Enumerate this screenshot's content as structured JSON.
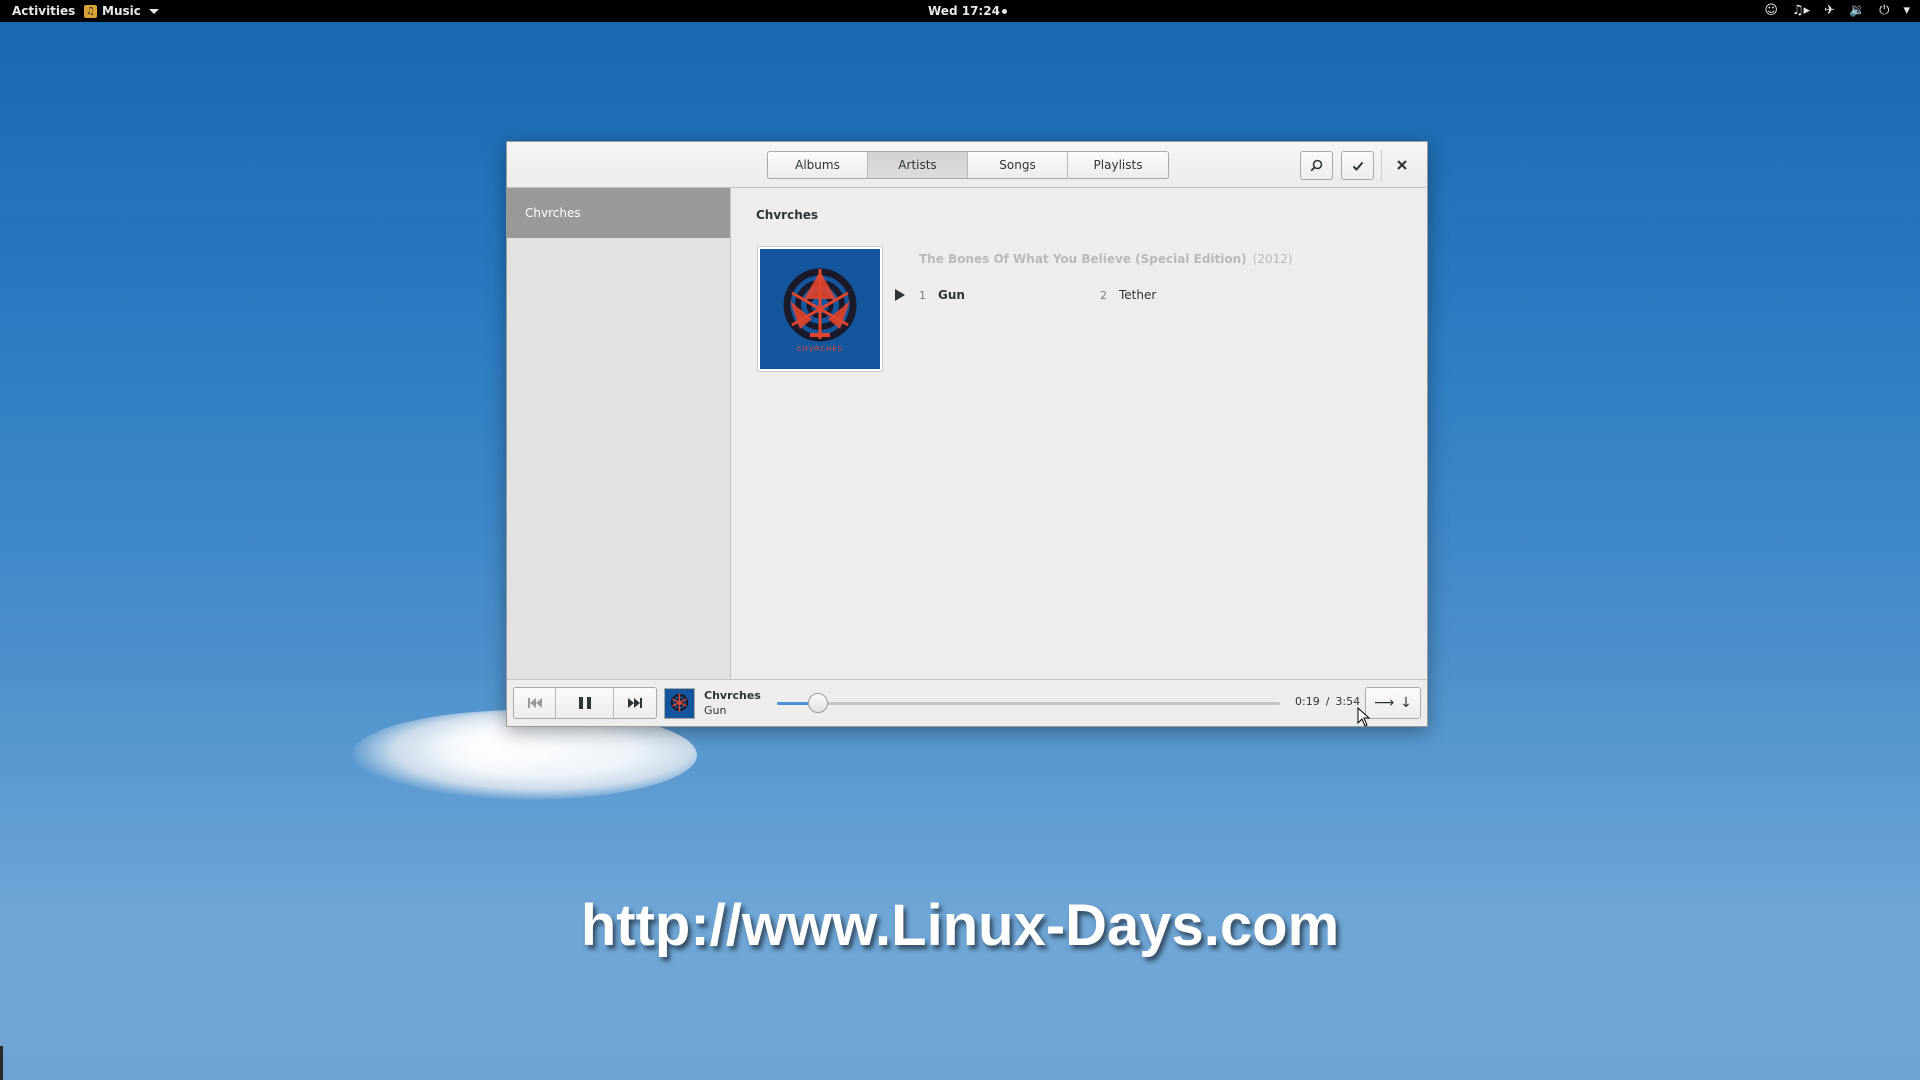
{
  "topbar": {
    "activities": "Activities",
    "app_name": "Music",
    "app_icon": "music-note-icon",
    "clock": "Wed 17:24",
    "status_icons": [
      "chat-icon",
      "music-player-icon",
      "network-icon",
      "volume-icon",
      "power-icon",
      "menu-caret-icon"
    ]
  },
  "window": {
    "tabs": [
      {
        "label": "Albums",
        "active": false
      },
      {
        "label": "Artists",
        "active": true
      },
      {
        "label": "Songs",
        "active": false
      },
      {
        "label": "Playlists",
        "active": false
      }
    ],
    "sidebar": {
      "items": [
        {
          "label": "Chvrches",
          "selected": true
        }
      ]
    },
    "content": {
      "artist": "Chvrches",
      "album": {
        "title": "The Bones Of What You Believe (Special Edition)",
        "year": "(2012)",
        "cover_text": "CHVRCHES",
        "tracks": [
          {
            "number": "1",
            "title": "Gun",
            "playing": true
          },
          {
            "number": "2",
            "title": "Tether",
            "playing": false
          }
        ]
      }
    },
    "player": {
      "artist": "Chvrches",
      "song": "Gun",
      "elapsed": "0:19",
      "total": "3:54",
      "separator": "/",
      "progress_fraction": 0.081
    }
  },
  "desktop": {
    "watermark": "http://www.Linux-Days.com"
  },
  "colors": {
    "accent": "#4a90d9",
    "sidebar_selected": "#999999",
    "cover_bg": "#13569e",
    "cover_red": "#e2452c"
  }
}
